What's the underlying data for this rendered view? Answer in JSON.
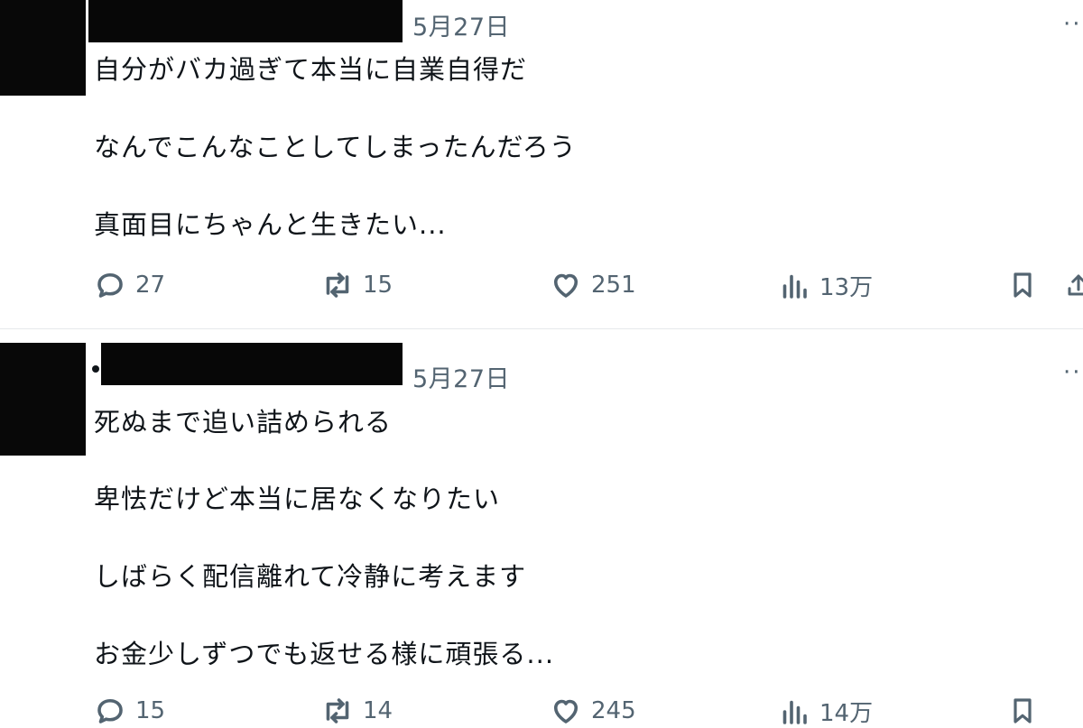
{
  "tweets": [
    {
      "date": "5月27日",
      "more": "··",
      "lines": [
        "自分がバカ過ぎて本当に自業自得だ",
        "なんでこんなことしてしまったんだろう",
        "真面目にちゃんと生きたい..."
      ],
      "replies": "27",
      "retweets": "15",
      "likes": "251",
      "views": "13万"
    },
    {
      "date": "5月27日",
      "more": "··",
      "lines": [
        "死ぬまで追い詰められる",
        "卑怯だけど本当に居なくなりたい",
        "しばらく配信離れて冷静に考えます",
        "お金少しずつでも返せる様に頑張る..."
      ],
      "replies": "15",
      "retweets": "14",
      "likes": "245",
      "views": "14万"
    }
  ],
  "icons": {
    "reply": "speech-bubble-icon",
    "retweet": "retweet-arrows-icon",
    "like": "heart-icon",
    "views": "bar-chart-icon",
    "bookmark": "bookmark-icon",
    "share": "share-upload-icon"
  },
  "colors": {
    "text": "#0f1419",
    "secondary": "#536471",
    "divider": "#e6e9eb",
    "redaction": "#080808"
  }
}
